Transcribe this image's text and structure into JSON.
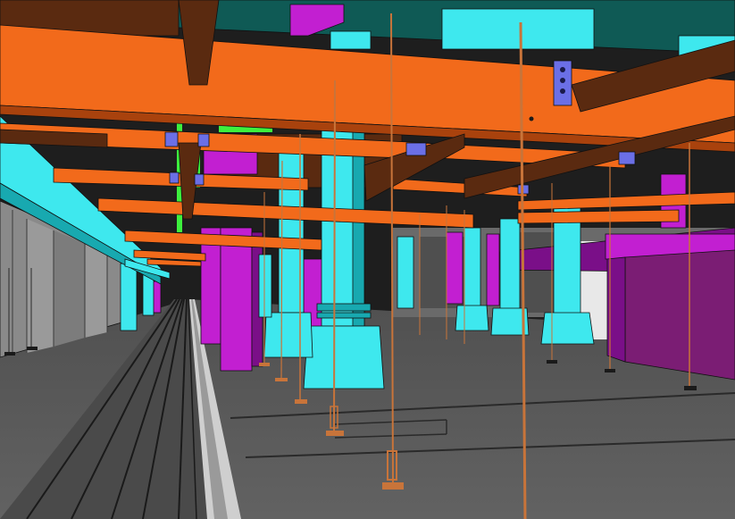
{
  "scene": {
    "kind": "bim-3d-model-render",
    "colors": {
      "beam_orange": "#f26a1b",
      "beam_orange_dark": "#a9420d",
      "beam_brown": "#5a2a10",
      "column_cyan": "#3ee8ee",
      "column_cyan_dark": "#18a9b0",
      "duct_magenta": "#c21fd1",
      "duct_magenta_dark": "#7a0f88",
      "duct_purple": "#7b1d74",
      "pipe_green": "#3df03d",
      "ceiling_teal": "#0f5a55",
      "floor_gray": "#5c5c5c",
      "wall_gray": "#8a8a8a",
      "rail_dark": "#2a2a2a",
      "plate_blue": "#6b6fe6",
      "rod_copper": "#c8743a"
    }
  }
}
